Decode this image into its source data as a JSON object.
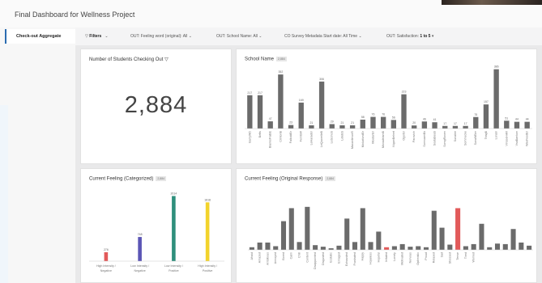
{
  "dashboard": {
    "title": "Final Dashboard for Wellness Project"
  },
  "sidebar": {
    "items": [
      {
        "label": "Check-out Aggregate"
      }
    ]
  },
  "filters": {
    "filter_label": "Filters",
    "items": [
      {
        "label": "OUT: Feeling word (original):",
        "value": "All"
      },
      {
        "label": "OUT: School Name:",
        "value": "All"
      },
      {
        "label": "CO Survey Metadata Start date:",
        "value": "All Time"
      },
      {
        "label": "OUT: Satisfaction:",
        "value": "1 to 5"
      }
    ]
  },
  "kpi": {
    "title": "Number of Students Checking Out",
    "value": "2,884"
  },
  "school_chart": {
    "title": "School Name",
    "badge": "2,884"
  },
  "categorized_chart": {
    "title": "Current Feeling (Categorized)",
    "badge": "2,884"
  },
  "original_chart": {
    "title": "Current Feeling (Original Response)",
    "badge": "2,884"
  },
  "colors": {
    "bar_gray": "#6b6b6b",
    "red": "#e25a5a",
    "purple": "#5b55b5",
    "teal": "#2e8f7c",
    "yellow": "#f2d32c",
    "accent_blue": "#2b6cb0"
  },
  "chart_data": [
    {
      "type": "bar",
      "title": "School Name",
      "categories": [
        "BarryWD",
        "Betts",
        "BlanksFraBE",
        "ClintonB",
        "FalkoldBr",
        "FernBW",
        "LeHaraeBr",
        "LeQuorelleB",
        "LeScinoS",
        "LoteBS",
        "MacanllmonR",
        "MolucfundBr",
        "MoutanBr",
        "MovadelamB",
        "NiganBelnet",
        "OgerBr",
        "Parovich",
        "SonnuamBk",
        "SoutaBeaS",
        "SomgRoven",
        "Sunalee",
        "Sommecke",
        "SunaWBer",
        "TeagB",
        "Lorabr",
        "VinceeHAR",
        "VsaBankon",
        "WavFeedBr"
      ],
      "values": [
        217,
        217,
        47,
        352,
        23,
        169,
        21,
        306,
        29,
        21,
        21,
        58,
        76,
        76,
        56,
        223,
        20,
        46,
        41,
        17,
        17,
        17,
        75,
        157,
        386,
        51,
        44,
        44
      ],
      "ylim": [
        0,
        400
      ]
    },
    {
      "type": "bar",
      "title": "Current Feeling (Categorized)",
      "categories": [
        "High Intensity / Negative",
        "Low Intensity / Negative",
        "Low Intensity / Positive",
        "High Intensity / Positive"
      ],
      "values": [
        276,
        748,
        2014,
        1818
      ],
      "colors": [
        "#e25a5a",
        "#5b55b5",
        "#2e8f7c",
        "#f2d32c"
      ],
      "ylim": [
        0,
        2100
      ]
    },
    {
      "type": "bar",
      "title": "Current Feeling (Original Response)",
      "categories": [
        "Afraid",
        "Amazed",
        "Ambitious",
        "Annoyed",
        "Bored",
        "Calm",
        "Chill",
        "Content",
        "Disappointed",
        "Disgusted",
        "Ecstatic",
        "Enraged",
        "Exhausted",
        "Frustrated",
        "Happy",
        "Hopeless",
        "Hopeful",
        "Irritated",
        "Lonely",
        "Motivated",
        "Nervous",
        "Optimistic",
        "Proud",
        "Relaxed",
        "Sad",
        "Stressed",
        "Tense",
        "Tired",
        "Worried"
      ],
      "values": [
        10,
        28,
        28,
        14,
        110,
        160,
        30,
        165,
        18,
        12,
        6,
        16,
        120,
        30,
        160,
        30,
        70,
        10,
        14,
        22,
        12,
        14,
        10,
        150,
        85,
        20,
        160,
        14,
        22,
        100,
        10,
        24,
        22,
        80,
        28,
        16
      ],
      "red_indices": [
        17,
        26
      ],
      "ylim": [
        0,
        180
      ]
    }
  ]
}
